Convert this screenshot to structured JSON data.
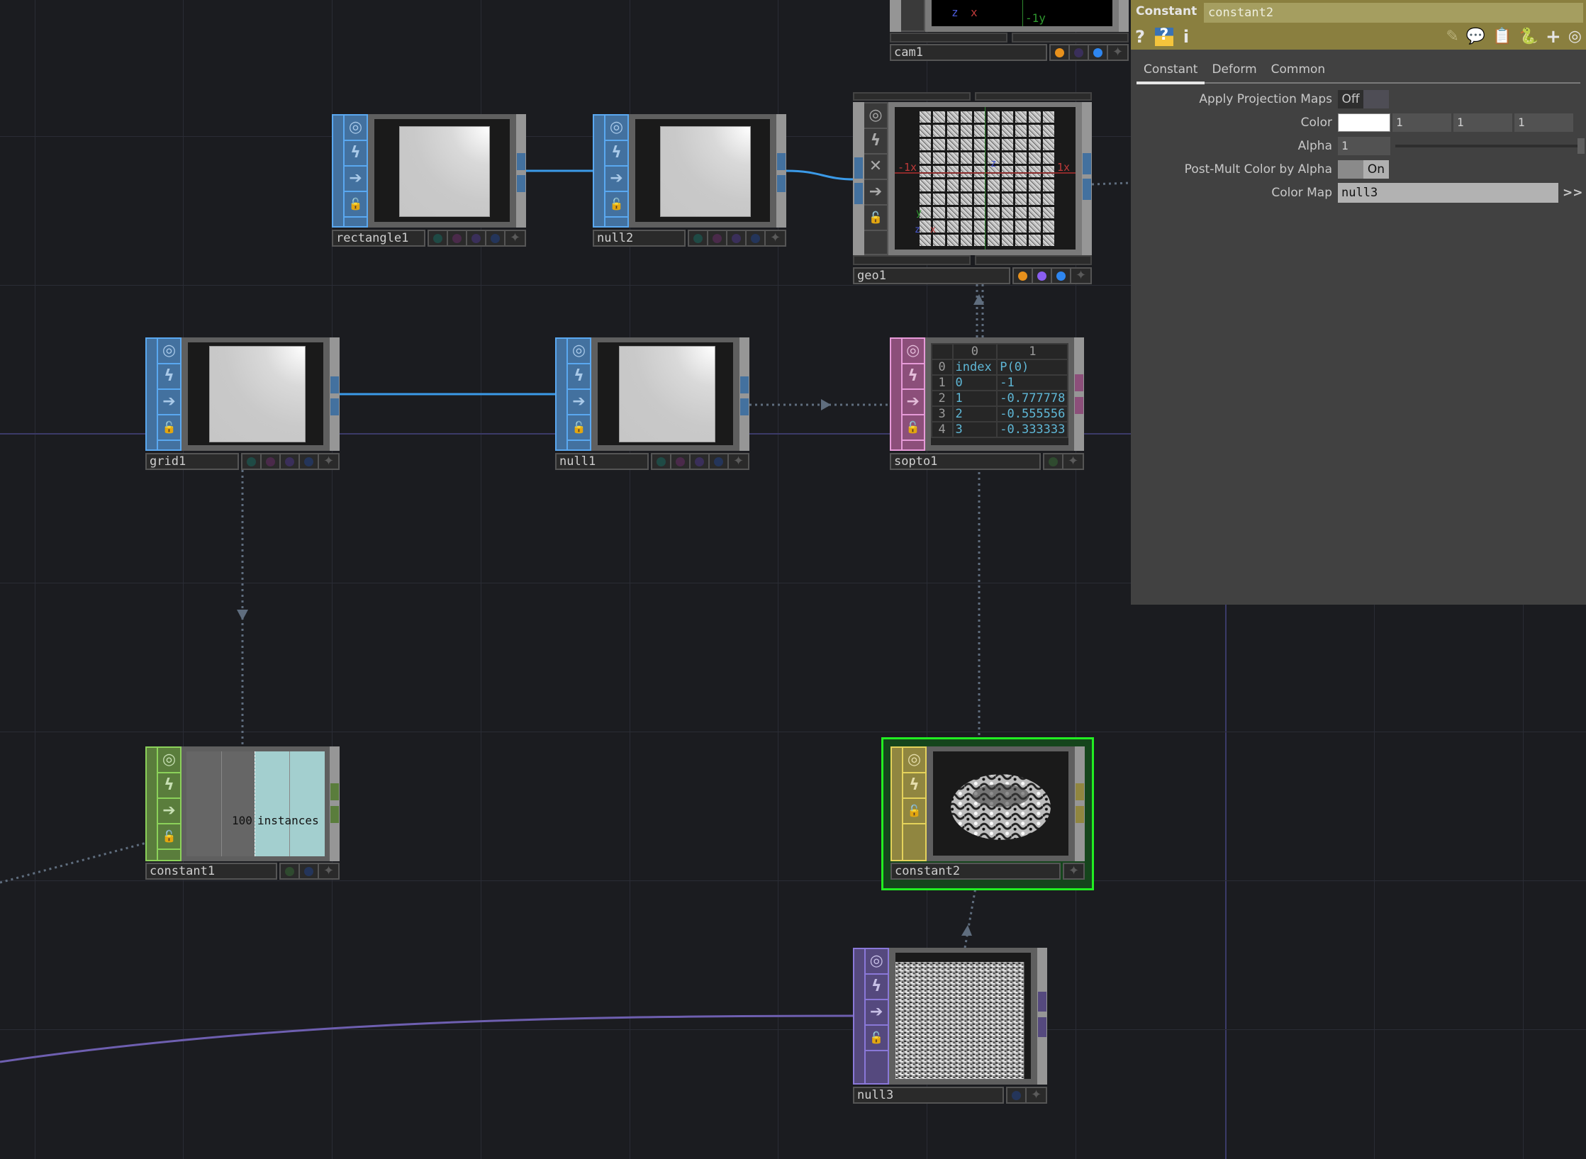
{
  "network": {
    "colors": {
      "top": "#43719f",
      "sop": "#959595",
      "dat": "#8c4f7a",
      "chop": "#5a7d3c",
      "mat": "#908640",
      "top_purple": "#55497e",
      "selection": "#22ee22",
      "wire_top": "#3b9ae8",
      "wire_purple": "#6e5fb0",
      "wire_dotted": "#5f6d7e"
    },
    "node_buttons": {
      "viewer": "◎",
      "bypass": "ϟ",
      "clone": "✕",
      "display": "➔",
      "lock": "🔓"
    },
    "nodes": [
      {
        "id": "rectangle1",
        "label": "rectangle1",
        "family": "TOP",
        "preview": "white-square"
      },
      {
        "id": "null2",
        "label": "null2",
        "family": "TOP",
        "preview": "white-square"
      },
      {
        "id": "geo1",
        "label": "geo1",
        "family": "COMP",
        "preview": "instanced-grid",
        "viewer_labels": {
          "neg_x": "-1x",
          "pos_x": "1x",
          "z": "z",
          "y": "y",
          "x": "x"
        }
      },
      {
        "id": "cam1",
        "label": "cam1",
        "family": "COMP",
        "viewer_labels": {
          "y": "-1y",
          "z": "z",
          "x": "x"
        }
      },
      {
        "id": "grid1",
        "label": "grid1",
        "family": "TOP",
        "preview": "white-square"
      },
      {
        "id": "null1",
        "label": "null1",
        "family": "TOP",
        "preview": "white-square"
      },
      {
        "id": "sopto1",
        "label": "sopto1",
        "family": "DAT",
        "preview": "table"
      },
      {
        "id": "constant1",
        "label": "constant1",
        "family": "CHOP",
        "preview": "instances",
        "instances_count": "100",
        "instances_label": "instances"
      },
      {
        "id": "constant2",
        "label": "constant2",
        "family": "MAT",
        "preview": "torus",
        "selected": true
      },
      {
        "id": "null3",
        "label": "null3",
        "family": "TOP",
        "preview": "noise"
      }
    ],
    "sopto1_table": {
      "col_headers": [
        "",
        "0",
        "1"
      ],
      "rows": [
        [
          "0",
          "index",
          "P(0)"
        ],
        [
          "1",
          "0",
          "-1"
        ],
        [
          "2",
          "1",
          "-0.777778"
        ],
        [
          "3",
          "2",
          "-0.555556"
        ],
        [
          "4",
          "3",
          "-0.333333"
        ]
      ]
    }
  },
  "params": {
    "op_type": "Constant",
    "op_name": "constant2",
    "header_icons_left": [
      "help-icon",
      "python-help-icon",
      "info-icon"
    ],
    "header_icons_left_glyphs": [
      "?",
      "?",
      "i"
    ],
    "header_icons_right_glyphs": [
      "✎",
      "💬",
      "📋",
      "🐍",
      "+",
      "◎"
    ],
    "tabs": [
      {
        "label": "Constant",
        "active": true
      },
      {
        "label": "Deform",
        "active": false
      },
      {
        "label": "Common",
        "active": false
      }
    ],
    "apply_projection_maps": {
      "label": "Apply Projection Maps",
      "value": "Off"
    },
    "color": {
      "label": "Color",
      "swatch": "#ffffff",
      "r": "1",
      "g": "1",
      "b": "1"
    },
    "alpha": {
      "label": "Alpha",
      "value": "1",
      "slider_fraction": 1.0
    },
    "post_mult": {
      "label": "Post-Mult Color by Alpha",
      "value": "On"
    },
    "color_map": {
      "label": "Color Map",
      "value": "null3",
      "more": ">>"
    }
  }
}
